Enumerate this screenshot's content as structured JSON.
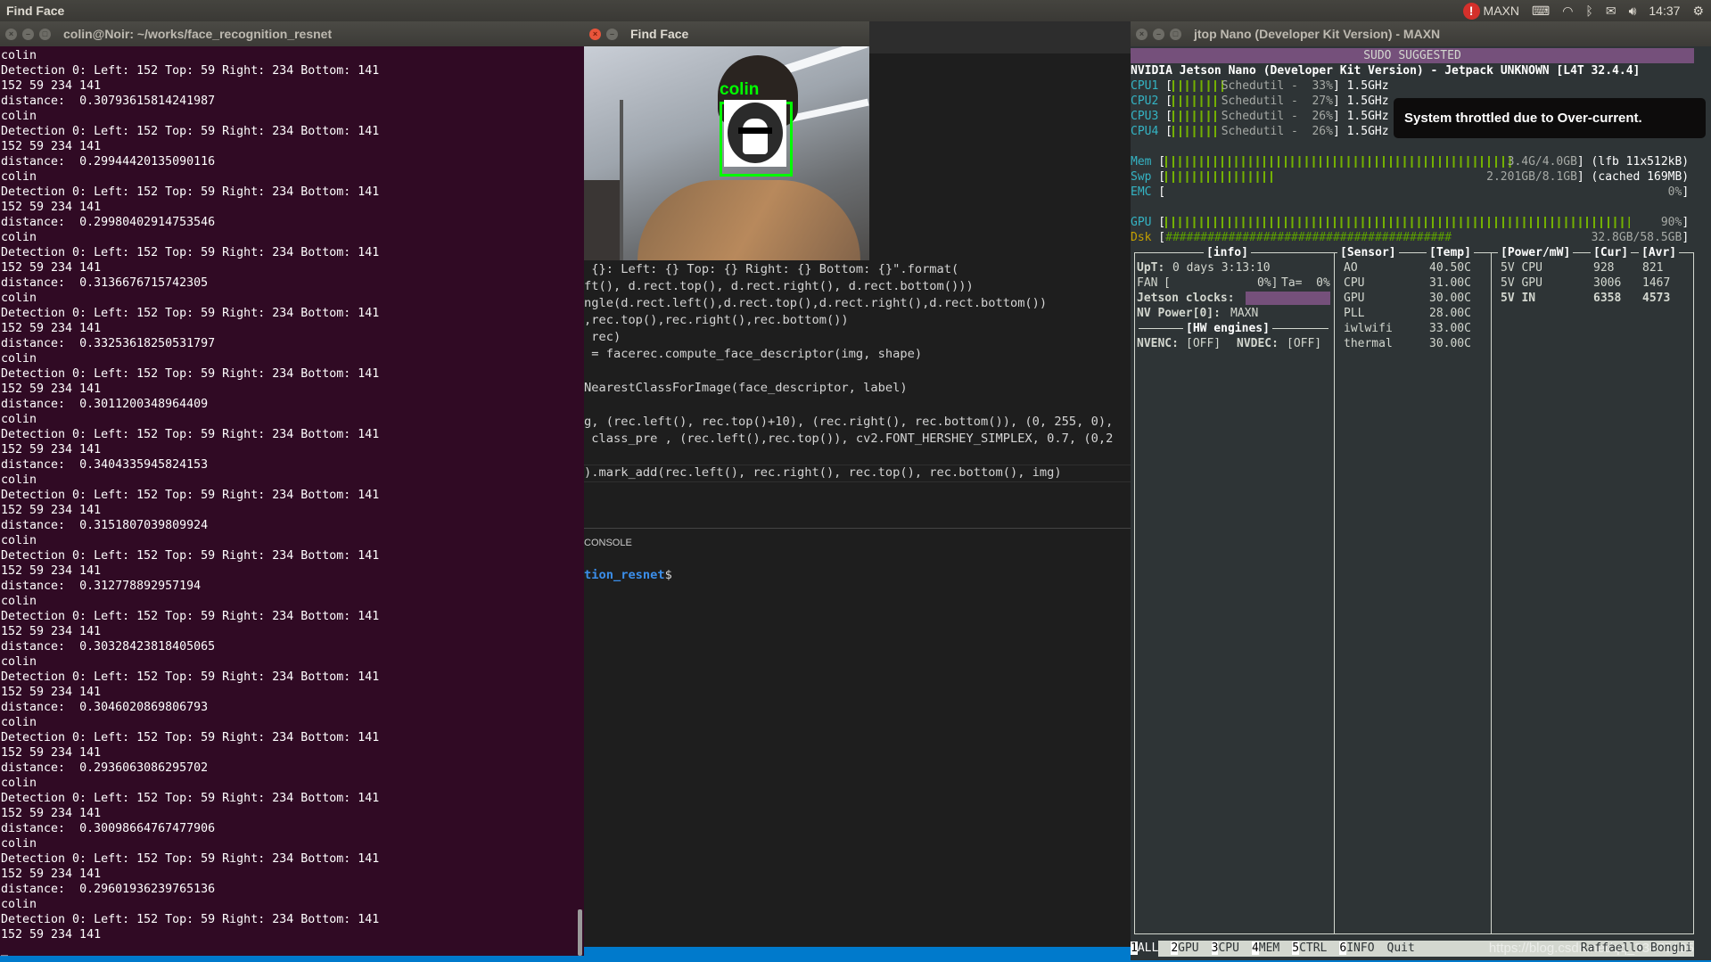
{
  "topbar": {
    "app_name": "Find Face",
    "power_mode": "MAXN",
    "time": "14:37",
    "icons": [
      "alert-icon",
      "keyboard-icon",
      "wifi-icon",
      "bluetooth-icon",
      "mail-icon",
      "volume-icon",
      "gear-icon"
    ]
  },
  "terminal": {
    "title": "colin@Noir: ~/works/face_recognition_resnet",
    "detection": "Detection 0: Left: 152 Top: 59 Right: 234 Bottom: 141",
    "coords": "152 59 234 141",
    "name": "colin",
    "distance_label": "distance:  ",
    "distances": [
      "0.30793615814241987",
      "0.29944420135090116",
      "0.29980402914753546",
      "0.3136676715742305",
      "0.33253618250531797",
      "0.3011200348964409",
      "0.3404335945824153",
      "0.3151807039809924",
      "0.312778892957194",
      "0.30328423818405065",
      "0.3046020869806793",
      "0.2936063086295702",
      "0.30098664767477906",
      "0.29601936239765136"
    ],
    "cursor": "_"
  },
  "findface": {
    "title": "Find Face",
    "label": "colin",
    "box_color": "#00ff00"
  },
  "editor": {
    "lines": [
      " {}: Left: {} Top: {} Right: {} Bottom: {}\".format(",
      "ft(), d.rect.top(), d.rect.right(), d.rect.bottom()))",
      "ngle(d.rect.left(),d.rect.top(),d.rect.right(),d.rect.bottom())",
      ",rec.top(),rec.right(),rec.bottom())",
      " rec)",
      " = facerec.compute_face_descriptor(img, shape)",
      "",
      "NearestClassForImage(face_descriptor, label)",
      "",
      "g, (rec.left(), rec.top()+10), (rec.right(), rec.bottom()), (0, 255, 0),",
      " class_pre , (rec.left(),rec.top()), cv2.FONT_HERSHEY_SIMPLEX, 0.7, (0,2",
      "",
      ").mark_add(rec.left(), rec.right(), rec.top(), rec.bottom(), img)"
    ],
    "panel_tab": "CONSOLE",
    "prompt_path": "tion_resnet",
    "prompt_symbol": "$"
  },
  "jtop": {
    "title": "jtop Nano (Developer Kit Version) - MAXN",
    "banner": "SUDO SUGGESTED",
    "board": "NVIDIA Jetson Nano (Developer Kit Version) - Jetpack UNKNOWN [L4T 32.4.4]",
    "cpus": [
      {
        "label": "CPU1",
        "governor": "Schedutil -",
        "percent": 33,
        "freq": "1.5GHz"
      },
      {
        "label": "CPU2",
        "governor": "Schedutil -",
        "percent": 27,
        "freq": "1.5GHz"
      },
      {
        "label": "CPU3",
        "governor": "Schedutil -",
        "percent": 26,
        "freq": "1.5GHz"
      },
      {
        "label": "CPU4",
        "governor": "Schedutil -",
        "percent": 26,
        "freq": "1.5GHz"
      }
    ],
    "mem": {
      "label": "Mem",
      "value": "3.4G/4.0GB",
      "fraction": 0.85,
      "extra": "(lfb 11x512kB)"
    },
    "swp": {
      "label": "Swp",
      "value": "2.201GB/8.1GB",
      "fraction": 0.27,
      "extra": "(cached 169MB)"
    },
    "emc": {
      "label": "EMC",
      "value": "0%",
      "fraction": 0
    },
    "gpu": {
      "label": "GPU",
      "value": "90%",
      "fraction": 0.9
    },
    "dsk": {
      "label": "Dsk",
      "value": "32.8GB/58.5GB",
      "fraction": 0.56
    },
    "info": {
      "header": "[info]",
      "uptime_label": "UpT:",
      "uptime": "0 days 3:13:10",
      "fan_label": "FAN",
      "fan": "0%]",
      "ta": "Ta=  0%",
      "clocks_label": "Jetson clocks:",
      "nvp_label": "NV Power[0]:",
      "nvp": "MAXN",
      "hw_header": "[HW engines]",
      "nvenc_label": "NVENC:",
      "nvenc": "[OFF]",
      "nvdec_label": "NVDEC:",
      "nvdec": "[OFF]"
    },
    "sensors": {
      "header": "[Sensor]",
      "temp_header": "[Temp]",
      "rows": [
        {
          "name": "AO",
          "temp": "40.50C"
        },
        {
          "name": "CPU",
          "temp": "31.00C"
        },
        {
          "name": "GPU",
          "temp": "30.00C"
        },
        {
          "name": "PLL",
          "temp": "28.00C"
        },
        {
          "name": "iwlwifi",
          "temp": "33.00C"
        },
        {
          "name": "thermal",
          "temp": "30.00C"
        }
      ]
    },
    "power": {
      "header": "[Power/mW]",
      "cur_header": "[Cur]",
      "avr_header": "[Avr]",
      "rows": [
        {
          "name": "5V CPU",
          "cur": "928",
          "avr": "821"
        },
        {
          "name": "5V GPU",
          "cur": "3006",
          "avr": "1467"
        },
        {
          "name": "5V IN",
          "cur": "6358",
          "avr": "4573"
        }
      ]
    },
    "tabs": [
      {
        "n": "1",
        "label": "ALL"
      },
      {
        "n": "2",
        "label": "GPU"
      },
      {
        "n": "3",
        "label": "CPU"
      },
      {
        "n": "4",
        "label": "MEM"
      },
      {
        "n": "5",
        "label": "CTRL"
      },
      {
        "n": "6",
        "label": "INFO"
      },
      {
        "n": "",
        "label": "Quit"
      }
    ],
    "author": "Raffaello Bonghi",
    "watermark": "https://blog.csdn.net/qq_33475105",
    "tooltip": "System throttled due to Over-current.",
    "colors": {
      "banner": "#75507b",
      "bar": "#73b000",
      "label": "#34b4c4",
      "warn": "#c4a000"
    }
  }
}
